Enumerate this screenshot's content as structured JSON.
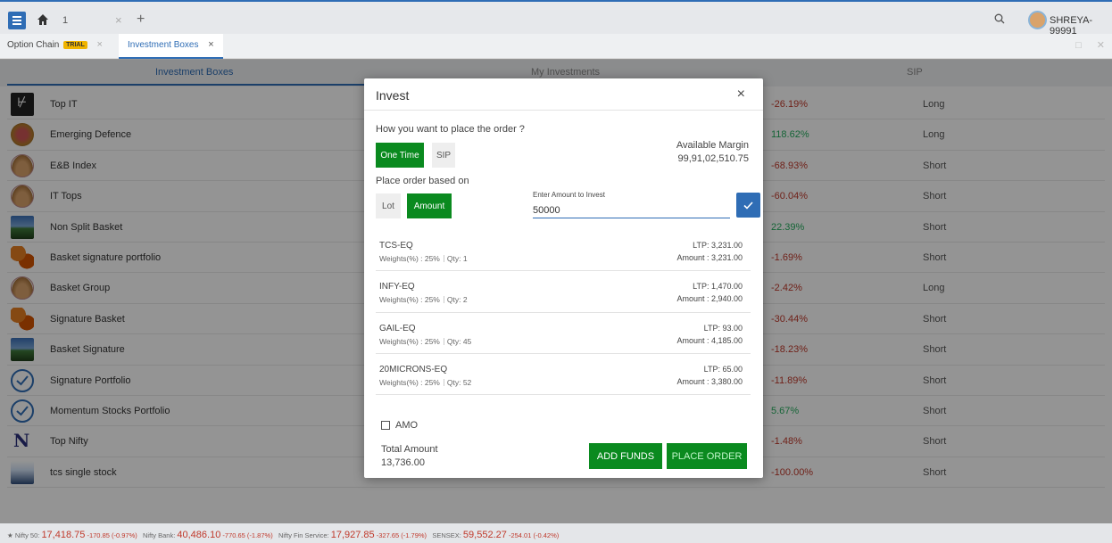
{
  "topbar": {
    "tab_number": "1",
    "tab_close": "×",
    "tab_add": "+",
    "user_name": "SHREYA-99991"
  },
  "subtabs": {
    "option_chain": "Option Chain",
    "trial_badge": "TRIAL",
    "investment_boxes": "Investment Boxes",
    "close": "×"
  },
  "main_tabs": {
    "investment_boxes": "Investment Boxes",
    "my_investments": "My Investments",
    "sip": "SIP"
  },
  "baskets": [
    {
      "name": "Top IT",
      "return": "-26.19%",
      "position": "Long",
      "sign": "neg",
      "thumb": "dark"
    },
    {
      "name": "Emerging Defence",
      "return": "118.62%",
      "position": "Long",
      "sign": "pos",
      "thumb": "emblem"
    },
    {
      "name": "E&B Index",
      "return": "-68.93%",
      "position": "Short",
      "sign": "neg",
      "thumb": "basket"
    },
    {
      "name": "IT Tops",
      "return": "-60.04%",
      "position": "Short",
      "sign": "neg",
      "thumb": "basket"
    },
    {
      "name": "Non Split Basket",
      "return": "22.39%",
      "position": "Short",
      "sign": "pos",
      "thumb": "scene"
    },
    {
      "name": "Basket signature portfolio",
      "return": "-1.69%",
      "position": "Short",
      "sign": "neg",
      "thumb": "leaf"
    },
    {
      "name": "Basket Group",
      "return": "-2.42%",
      "position": "Long",
      "sign": "neg",
      "thumb": "basket"
    },
    {
      "name": "Signature Basket",
      "return": "-30.44%",
      "position": "Short",
      "sign": "neg",
      "thumb": "leaf"
    },
    {
      "name": "Basket Signature",
      "return": "-18.23%",
      "position": "Short",
      "sign": "neg",
      "thumb": "scene"
    },
    {
      "name": "Signature Portfolio",
      "return": "-11.89%",
      "position": "Short",
      "sign": "neg",
      "thumb": "check"
    },
    {
      "name": "Momentum Stocks Portfolio",
      "return": "5.67%",
      "position": "Short",
      "sign": "pos",
      "thumb": "check"
    },
    {
      "name": "Top Nifty",
      "return": "-1.48%",
      "position": "Short",
      "sign": "neg",
      "thumb": "nifty"
    },
    {
      "name": "tcs single stock",
      "return": "-100.00%",
      "position": "Short",
      "sign": "neg",
      "thumb": "chart"
    }
  ],
  "modal": {
    "title": "Invest",
    "close": "×",
    "order_question": "How you want to place the order ?",
    "one_time": "One Time",
    "sip": "SIP",
    "available_margin_label": "Available Margin",
    "available_margin_value": "99,91,02,510.75",
    "place_based_on": "Place order based on",
    "lot": "Lot",
    "amount": "Amount",
    "amount_label": "Enter Amount to Invest",
    "amount_value": "50000",
    "items": [
      {
        "symbol": "TCS-EQ",
        "weights": "Weights(%) : 25%",
        "qty": "Qty: 1",
        "ltp": "LTP: 3,231.00",
        "amount": "Amount : 3,231.00"
      },
      {
        "symbol": "INFY-EQ",
        "weights": "Weights(%) : 25%",
        "qty": "Qty: 2",
        "ltp": "LTP: 1,470.00",
        "amount": "Amount : 2,940.00"
      },
      {
        "symbol": "GAIL-EQ",
        "weights": "Weights(%) : 25%",
        "qty": "Qty: 45",
        "ltp": "LTP: 93.00",
        "amount": "Amount : 4,185.00"
      },
      {
        "symbol": "20MICRONS-EQ",
        "weights": "Weights(%) : 25%",
        "qty": "Qty: 52",
        "ltp": "LTP: 65.00",
        "amount": "Amount : 3,380.00"
      }
    ],
    "amo_label": "AMO",
    "total_label": "Total Amount",
    "total_value": "13,736.00",
    "add_funds": "ADD FUNDS",
    "place_order": "PLACE ORDER"
  },
  "ticker": [
    {
      "name": "Nifty 50:",
      "value": "17,418.75",
      "change": "-170.85 (-0.97%)"
    },
    {
      "name": "Nifty Bank:",
      "value": "40,486.10",
      "change": "-770.65 (-1.87%)"
    },
    {
      "name": "Nifty Fin Service:",
      "value": "17,927.85",
      "change": "-327.65 (-1.79%)"
    },
    {
      "name": "SENSEX:",
      "value": "59,552.27",
      "change": "-254.01 (-0.42%)"
    }
  ]
}
